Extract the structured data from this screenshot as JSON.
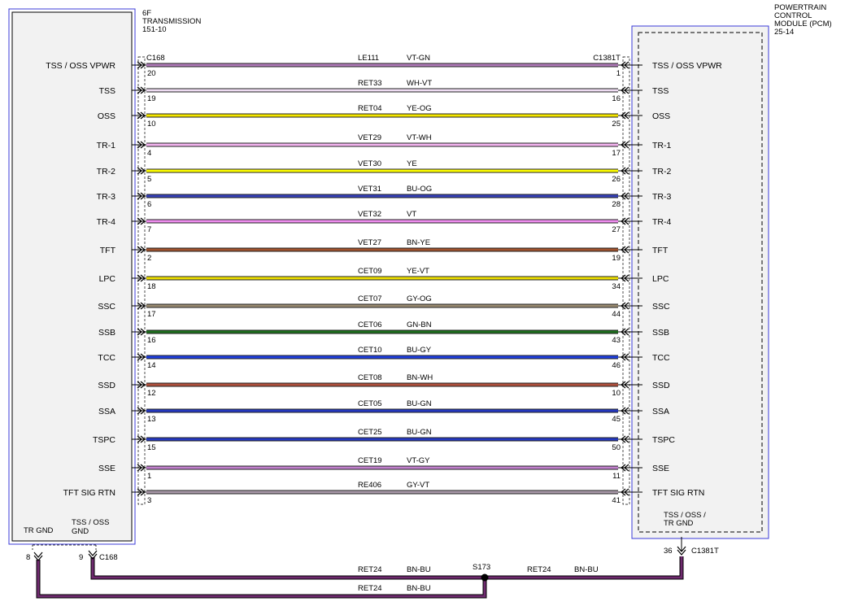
{
  "left_module": {
    "title_lines": [
      "6F",
      "TRANSMISSION",
      "151-10"
    ],
    "connector": "C168",
    "ground_labels": [
      "TR GND",
      "TSS / OSS",
      "GND"
    ]
  },
  "right_module": {
    "title_lines": [
      "POWERTRAIN",
      "CONTROL",
      "MODULE (PCM)",
      "25-14"
    ],
    "connector": "C1381T",
    "ground_labels": [
      "TSS / OSS /",
      "TR GND"
    ]
  },
  "circuits": [
    {
      "left_label": "TSS / OSS VPWR",
      "right_label": "TSS / OSS VPWR",
      "left_pin": "20",
      "right_pin": "1",
      "circuit": "LE111",
      "color_code": "VT-GN",
      "color": "#b07ab8"
    },
    {
      "left_label": "TSS",
      "right_label": "TSS",
      "left_pin": "19",
      "right_pin": "16",
      "circuit": "RET33",
      "color_code": "WH-VT",
      "color": "#eedcf2"
    },
    {
      "left_label": "OSS",
      "right_label": "OSS",
      "left_pin": "10",
      "right_pin": "25",
      "circuit": "RET04",
      "color_code": "YE-OG",
      "color": "#f4e600"
    },
    {
      "left_label": "TR-1",
      "right_label": "TR-1",
      "left_pin": "4",
      "right_pin": "17",
      "circuit": "VET29",
      "color_code": "VT-WH",
      "color": "#f4b4f0"
    },
    {
      "left_label": "TR-2",
      "right_label": "TR-2",
      "left_pin": "5",
      "right_pin": "26",
      "circuit": "VET30",
      "color_code": "YE",
      "color": "#ffff00"
    },
    {
      "left_label": "TR-3",
      "right_label": "TR-3",
      "left_pin": "6",
      "right_pin": "28",
      "circuit": "VET31",
      "color_code": "BU-OG",
      "color": "#3540b8"
    },
    {
      "left_label": "TR-4",
      "right_label": "TR-4",
      "left_pin": "7",
      "right_pin": "27",
      "circuit": "VET32",
      "color_code": "VT",
      "color": "#f08ef0"
    },
    {
      "left_label": "TFT",
      "right_label": "TFT",
      "left_pin": "2",
      "right_pin": "19",
      "circuit": "VET27",
      "color_code": "BN-YE",
      "color": "#a0522d"
    },
    {
      "left_label": "LPC",
      "right_label": "LPC",
      "left_pin": "18",
      "right_pin": "34",
      "circuit": "CET09",
      "color_code": "YE-VT",
      "color": "#eee000"
    },
    {
      "left_label": "SSC",
      "right_label": "SSC",
      "left_pin": "17",
      "right_pin": "44",
      "circuit": "CET07",
      "color_code": "GY-OG",
      "color": "#998a70"
    },
    {
      "left_label": "SSB",
      "right_label": "SSB",
      "left_pin": "16",
      "right_pin": "43",
      "circuit": "CET06",
      "color_code": "GN-BN",
      "color": "#1e6e1e"
    },
    {
      "left_label": "TCC",
      "right_label": "TCC",
      "left_pin": "14",
      "right_pin": "46",
      "circuit": "CET10",
      "color_code": "BU-GY",
      "color": "#1e3ee0"
    },
    {
      "left_label": "SSD",
      "right_label": "SSD",
      "left_pin": "12",
      "right_pin": "10",
      "circuit": "CET08",
      "color_code": "BN-WH",
      "color": "#b0503c"
    },
    {
      "left_label": "SSA",
      "right_label": "SSA",
      "left_pin": "13",
      "right_pin": "45",
      "circuit": "CET05",
      "color_code": "BU-GN",
      "color": "#2438c0"
    },
    {
      "left_label": "TSPC",
      "right_label": "TSPC",
      "left_pin": "15",
      "right_pin": "50",
      "circuit": "CET25",
      "color_code": "BU-GN",
      "color": "#2438c0"
    },
    {
      "left_label": "SSE",
      "right_label": "SSE",
      "left_pin": "1",
      "right_pin": "11",
      "circuit": "CET19",
      "color_code": "VT-GY",
      "color": "#c080cc"
    },
    {
      "left_label": "TFT SIG RTN",
      "right_label": "TFT SIG RTN",
      "left_pin": "3",
      "right_pin": "41",
      "circuit": "RE406",
      "color_code": "GY-VT",
      "color": "#a898a8"
    }
  ],
  "grounds": {
    "left_pins": [
      "8",
      "9"
    ],
    "left_connector": "C168",
    "right_pin": "36",
    "right_connector": "C1381T",
    "splice": "S173",
    "upper_run": {
      "circuit_left": "RET24",
      "color_left": "BN-BU",
      "circuit_right": "RET24",
      "color_right": "BN-BU"
    },
    "lower_run": {
      "circuit": "RET24",
      "color_code": "BN-BU"
    },
    "wire_color": "#6e2a6e"
  },
  "styling": {
    "module_border": "#3b3bd8",
    "module_fill": "#f2f2f2"
  }
}
